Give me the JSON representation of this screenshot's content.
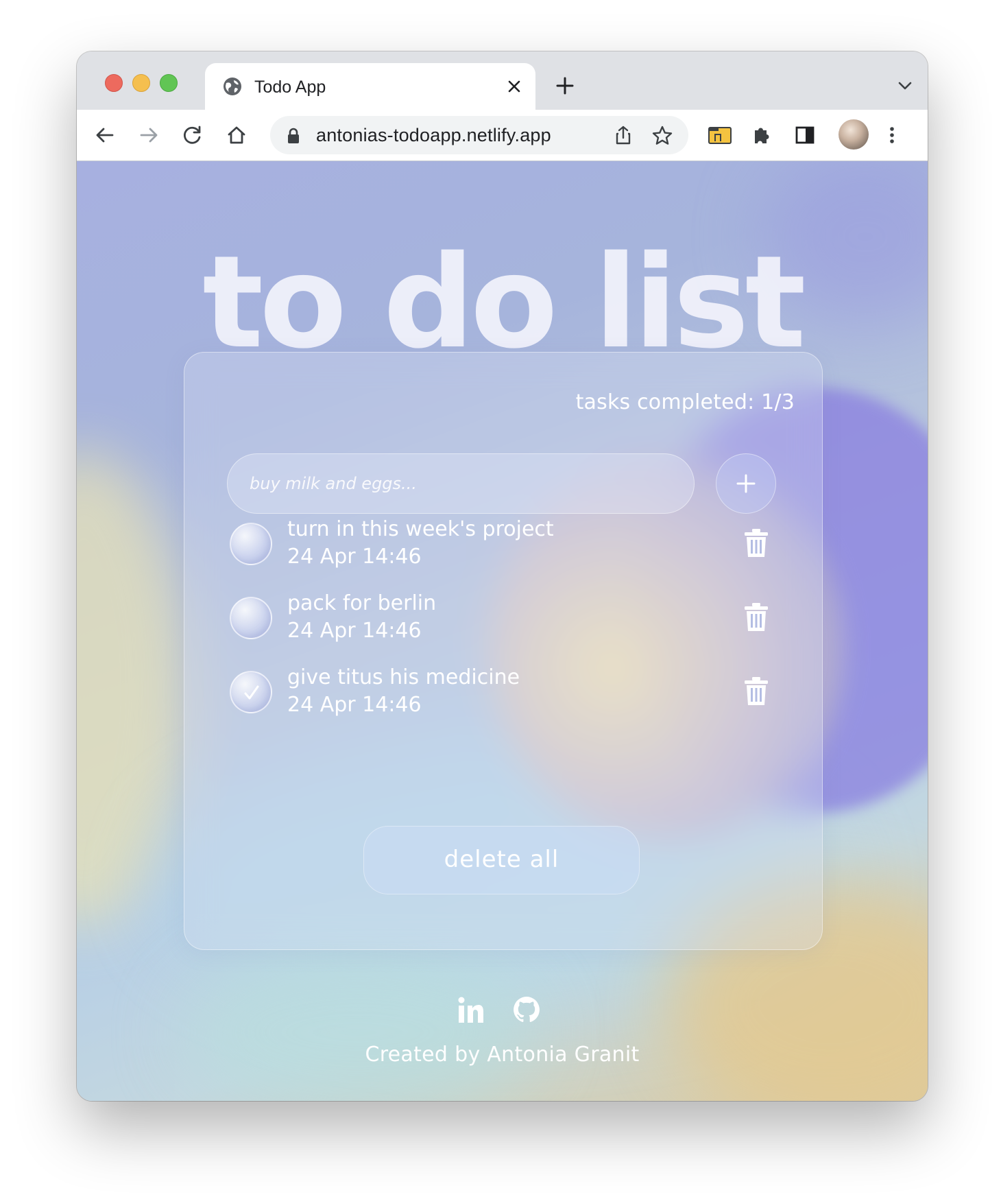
{
  "browser": {
    "tab_title": "Todo App",
    "url": "antonias-todoapp.netlify.app"
  },
  "app": {
    "heading": "to do list",
    "counter": "tasks completed: 1/3",
    "input_placeholder": "buy milk and eggs...",
    "tasks": [
      {
        "text": "turn in this week's project",
        "date": "24 Apr 14:46",
        "done": false
      },
      {
        "text": "pack for berlin",
        "date": "24 Apr 14:46",
        "done": false
      },
      {
        "text": "give titus his medicine",
        "date": "24 Apr 14:46",
        "done": true
      }
    ],
    "delete_all_label": "delete all",
    "footer_credit": "Created by Antonia Granit"
  },
  "icons": {
    "tab": "globe-icon",
    "social": [
      "linkedin-icon",
      "github-icon"
    ]
  },
  "colors": {
    "accent_purple": "#8a7fe0",
    "glass_border": "#ffffff"
  }
}
